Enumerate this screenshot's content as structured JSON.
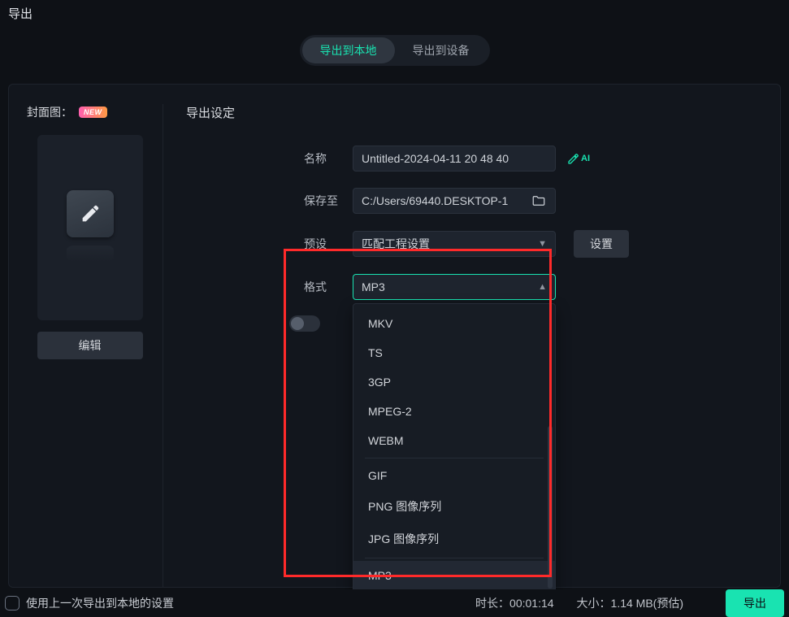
{
  "title": "导出",
  "tabs": {
    "local": "导出到本地",
    "device": "导出到设备"
  },
  "cover": {
    "label": "封面图：",
    "new_badge": "NEW",
    "edit_button": "编辑"
  },
  "settings": {
    "header": "导出设定",
    "name_label": "名称",
    "name_value": "Untitled-2024-04-11 20 48 40",
    "ai_label": "AI",
    "save_to_label": "保存至",
    "save_to_value": "C:/Users/69440.DESKTOP-1",
    "preset_label": "预设",
    "preset_value": "匹配工程设置",
    "settings_button": "设置",
    "format_label": "格式",
    "format_value": "MP3",
    "format_options": [
      "MKV",
      "TS",
      "3GP",
      "MPEG-2",
      "WEBM",
      "GIF",
      "PNG 图像序列",
      "JPG 图像序列",
      "MP3"
    ]
  },
  "bottom": {
    "use_last": "使用上一次导出到本地的设置",
    "duration_label": "时长：",
    "duration_value": "00:01:14",
    "size_label": "大小：",
    "size_value": "1.14 MB(预估)",
    "export_button": "导出"
  }
}
